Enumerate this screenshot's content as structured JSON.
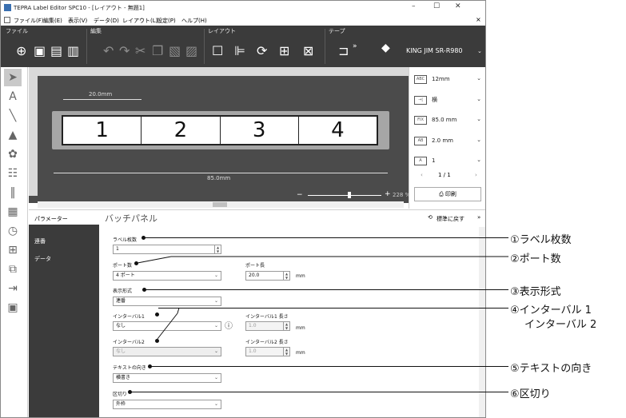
{
  "window": {
    "title": "TEPRA Label Editor SPC10 - [レイアウト - 無題1]",
    "controls": [
      "–",
      "☐",
      "✕"
    ]
  },
  "menu": [
    "ファイル(F)",
    "編集(E)",
    "表示(V)",
    "データ(D)",
    "レイアウト(L)",
    "設定(P)",
    "ヘルプ(H)"
  ],
  "ribbon": {
    "groups": [
      "ファイル",
      "編集",
      "レイアウト",
      "テープ"
    ],
    "printer": "KING JIM SR-R980"
  },
  "canvas": {
    "dim_top": "20.0mm",
    "dim_bottom": "85.0mm",
    "cells": [
      "1",
      "2",
      "3",
      "4"
    ],
    "zoom": "228 %"
  },
  "right_panel": {
    "items": [
      {
        "icon": "ABC",
        "value": "12mm"
      },
      {
        "icon": "→|",
        "value": "横"
      },
      {
        "icon": "FIX",
        "value": "85.0 mm"
      },
      {
        "icon": "AB",
        "value": "2.0 mm"
      },
      {
        "icon": "A",
        "value": "1"
      }
    ],
    "page": "1 / 1",
    "print_label": "印刷"
  },
  "bottom": {
    "tab_param": "パラメーター",
    "panel_title": "バッチパネル",
    "restore_label": "標準に戻す",
    "side_items": [
      "連番",
      "データ"
    ]
  },
  "form": {
    "label_count_label": "ラベル枚数",
    "label_count_value": "1",
    "port_count_label": "ポート数",
    "port_count_value": "4 ポート",
    "port_length_label": "ポート長",
    "port_length_value": "20.0",
    "mm": "mm",
    "display_format_label": "表示形式",
    "display_format_value": "連番",
    "interval1_label": "インターバル1",
    "interval1_value": "なし",
    "interval1_len_label": "インターバル1 長さ",
    "interval1_len_value": "1.0",
    "interval2_label": "インターバル2",
    "interval2_value": "なし",
    "interval2_len_label": "インターバル2 長さ",
    "interval2_len_value": "1.0",
    "text_dir_label": "テキストの向き",
    "text_dir_value": "横書き",
    "separator_label": "区切り",
    "separator_value": "外枠"
  },
  "callouts": {
    "c1": "①ラベル枚数",
    "c2": "②ポート数",
    "c3": "③表示形式",
    "c4a": "④インターバル 1",
    "c4b": "インターバル 2",
    "c5": "⑤テキストの向き",
    "c6": "⑥区切り"
  }
}
